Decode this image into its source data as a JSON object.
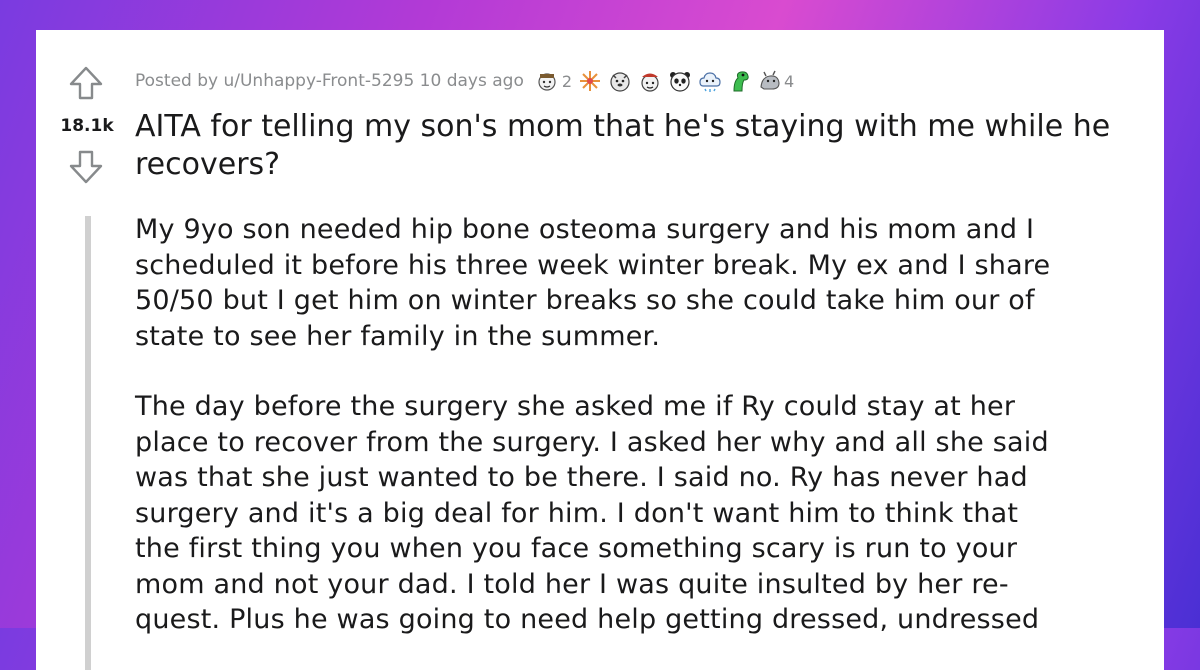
{
  "post": {
    "score": "18.1k",
    "posted_by": "Posted by u/Unhappy-Front-5295 10 days ago",
    "awards": [
      {
        "icon": "wholesome-award-icon",
        "count": "2"
      },
      {
        "icon": "sparkle-burst-award-icon",
        "count": ""
      },
      {
        "icon": "doge-face-award-icon",
        "count": ""
      },
      {
        "icon": "face-with-hat-award-icon",
        "count": ""
      },
      {
        "icon": "panda-face-award-icon",
        "count": ""
      },
      {
        "icon": "cloud-face-award-icon",
        "count": ""
      },
      {
        "icon": "green-creature-award-icon",
        "count": ""
      },
      {
        "icon": "gray-creature-award-icon",
        "count": "4"
      }
    ],
    "title": "AITA for telling my son's mom that he's staying with me while he recovers?",
    "paragraphs": [
      "My 9yo son needed hip bone osteoma surgery and his mom and I\nscheduled it before his three week winter break. My ex and I share\n50/50 but I get him on winter breaks so she could take him our of\nstate to see her family in the summer.",
      "The day before the surgery she asked me if Ry could stay at her\nplace to recover from the surgery. I asked her why and all she said\nwas that she just wanted to be there. I said no. Ry has never had\nsurgery and it's a big deal for him. I don't want him to think that\nthe first thing you when you face something scary is run to your\nmom and not your dad. I told her I was quite insulted by her re-\nquest. Plus he was going to need help getting dressed, undressed"
    ]
  },
  "colors": {
    "text": "#1a1a1b",
    "meta": "#8a8c8e",
    "quote_bar": "#d0d0d0",
    "card": "#ffffff"
  }
}
